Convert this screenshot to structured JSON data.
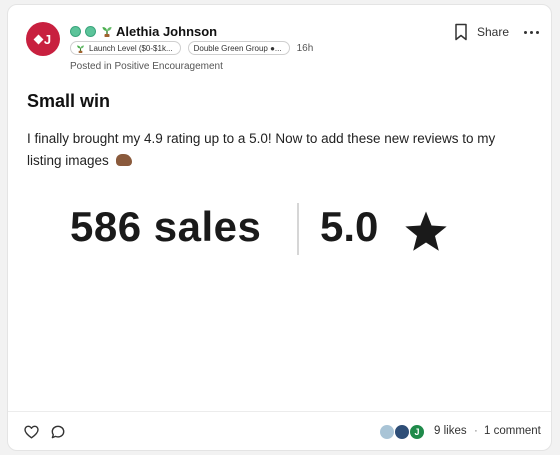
{
  "post": {
    "avatar_initial": "J",
    "author": "Alethia Johnson",
    "badges": [
      "Launch Level ($0-$1k...",
      "Double Green Group ●..."
    ],
    "time": "16h",
    "posted_in": "Posted in Positive Encouragement",
    "title": "Small win",
    "text": "I finally brought my 4.9 rating up to a 5.0!  Now to add these new reviews to my listing images",
    "image": {
      "sales": "586 sales",
      "rating": "5.0"
    }
  },
  "actions": {
    "share_label": "Share"
  },
  "footer": {
    "reactor_initial": "J",
    "likes": "9 likes",
    "separator": "·",
    "comments": "1 comment"
  },
  "colors": {
    "avatar": "#c8203f",
    "status_dot": "#5cc49a",
    "reactor_green": "#1f8a4a"
  },
  "icons": [
    "bookmark-icon",
    "more-icon",
    "heart-icon",
    "comment-icon",
    "star-icon",
    "sprout-icon",
    "flexed-biceps-emoji"
  ]
}
